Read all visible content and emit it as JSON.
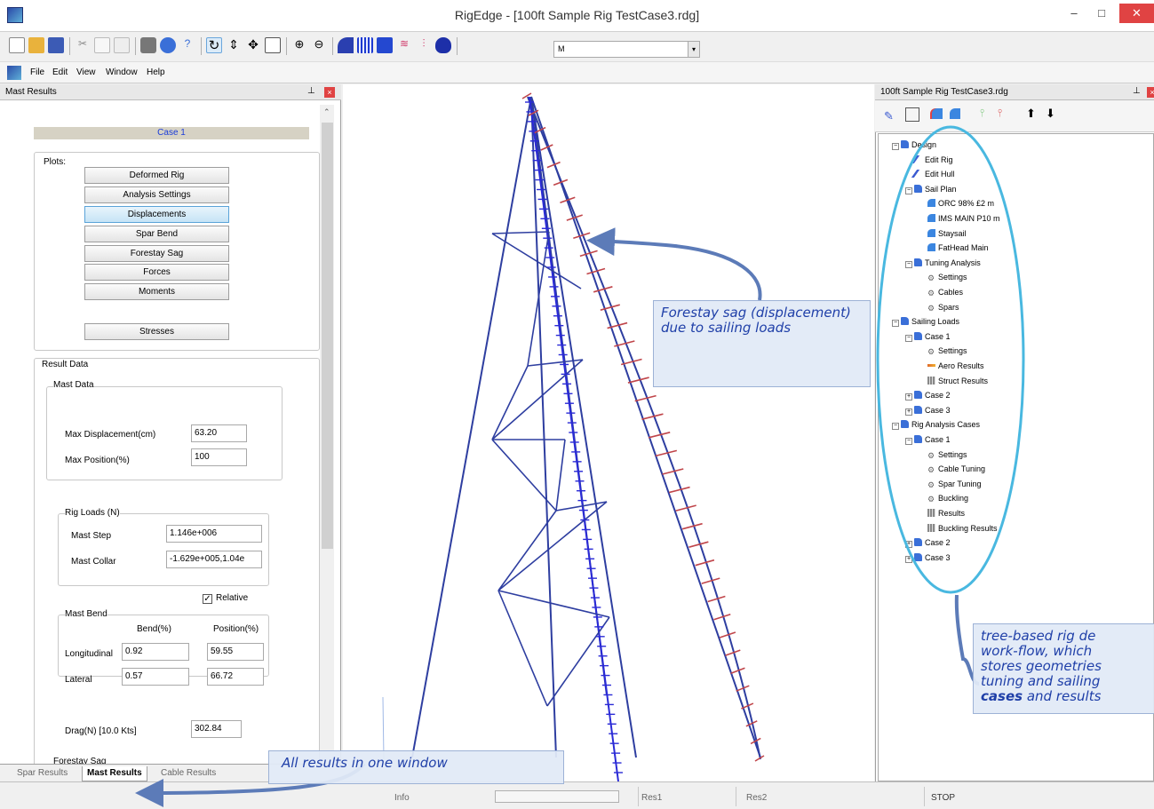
{
  "window": {
    "title": "RigEdge - [100ft Sample Rig TestCase3.rdg]",
    "minimize": "–",
    "maximize": "□",
    "close": "✕"
  },
  "toolbar": {
    "combo_value": "M",
    "combo_arrow": "▾"
  },
  "menubar": {
    "items": [
      "File",
      "Edit",
      "View",
      "Window",
      "Help"
    ]
  },
  "left_panel": {
    "title": "Mast Results",
    "case_label": "Case 1",
    "plots_label": "Plots:",
    "plot_buttons": [
      "Deformed Rig",
      "Analysis Settings",
      "Displacements",
      "Spar Bend",
      "Forestay Sag",
      "Forces",
      "Moments",
      "Stresses"
    ],
    "selected_plot": "Displacements",
    "result_data_label": "Result Data",
    "mast_data_label": "Mast Data",
    "max_displacement_label": "Max Displacement(cm)",
    "max_displacement_value": "63.20",
    "max_position_label": "Max Position(%)",
    "max_position_value": "100",
    "rig_loads_label": "Rig Loads (N)",
    "mast_step_label": "Mast Step",
    "mast_step_value": "1.146e+006",
    "mast_collar_label": "Mast Collar",
    "mast_collar_value": "-1.629e+005,1.04e",
    "relative_label": "Relative",
    "relative_checked": true,
    "mast_bend_label": "Mast Bend",
    "bend_header": "Bend(%)",
    "position_header": "Position(%)",
    "longitudinal_label": "Longitudinal",
    "longitudinal_bend": "0.92",
    "longitudinal_position": "59.55",
    "lateral_label": "Lateral",
    "lateral_bend": "0.57",
    "lateral_position": "66.72",
    "drag_label": "Drag(N) [10.0 Kts]",
    "drag_value": "302.84",
    "forestay_sag_label": "Forestay Sag",
    "tabs": [
      "Spar Results",
      "Mast Results",
      "Cable Results"
    ],
    "active_tab": "Mast Results"
  },
  "right_panel": {
    "title": "100ft Sample Rig TestCase3.rdg",
    "tree": [
      {
        "label": "Design",
        "level": 0,
        "icon": "folder-icon",
        "expander": "−"
      },
      {
        "label": "Edit Rig",
        "level": 1,
        "icon": "pencil-icon"
      },
      {
        "label": "Edit Hull",
        "level": 1,
        "icon": "pencil-icon"
      },
      {
        "label": "Sail Plan",
        "level": 1,
        "icon": "folder-icon",
        "expander": "−"
      },
      {
        "label": "ORC 98% £2 m",
        "level": 2,
        "icon": "sail-icon"
      },
      {
        "label": "IMS MAIN P10 m",
        "level": 2,
        "icon": "sail-icon"
      },
      {
        "label": "Staysail",
        "level": 2,
        "icon": "sail-icon"
      },
      {
        "label": "FatHead Main",
        "level": 2,
        "icon": "sail-icon"
      },
      {
        "label": "Tuning Analysis",
        "level": 1,
        "icon": "folder-icon",
        "expander": "−"
      },
      {
        "label": "Settings",
        "level": 2,
        "icon": "gear-icon"
      },
      {
        "label": "Cables",
        "level": 2,
        "icon": "gear-icon"
      },
      {
        "label": "Spars",
        "level": 2,
        "icon": "gear-icon"
      },
      {
        "label": "Sailing Loads",
        "level": 0,
        "icon": "folder-icon",
        "expander": "−"
      },
      {
        "label": "Case 1",
        "level": 1,
        "icon": "folder-icon",
        "expander": "−"
      },
      {
        "label": "Settings",
        "level": 2,
        "icon": "gear-icon"
      },
      {
        "label": "Aero Results",
        "level": 2,
        "icon": "aero-icon"
      },
      {
        "label": "Struct Results",
        "level": 2,
        "icon": "grid-icon"
      },
      {
        "label": "Case 2",
        "level": 1,
        "icon": "folder-icon",
        "expander": "+"
      },
      {
        "label": "Case 3",
        "level": 1,
        "icon": "folder-icon",
        "expander": "+"
      },
      {
        "label": "Rig Analysis Cases",
        "level": 0,
        "icon": "folder-icon",
        "expander": "−"
      },
      {
        "label": "Case 1",
        "level": 1,
        "icon": "folder-icon",
        "expander": "−"
      },
      {
        "label": "Settings",
        "level": 2,
        "icon": "gear-icon"
      },
      {
        "label": "Cable Tuning",
        "level": 2,
        "icon": "gear-icon"
      },
      {
        "label": "Spar Tuning",
        "level": 2,
        "icon": "gear-icon"
      },
      {
        "label": "Buckling",
        "level": 2,
        "icon": "gear-icon"
      },
      {
        "label": "Results",
        "level": 2,
        "icon": "grid-icon"
      },
      {
        "label": "Buckling Results",
        "level": 2,
        "icon": "grid-icon"
      },
      {
        "label": "Case 2",
        "level": 1,
        "icon": "folder-icon",
        "expander": "+"
      },
      {
        "label": "Case 3",
        "level": 1,
        "icon": "folder-icon",
        "expander": "+"
      }
    ]
  },
  "status_bar": {
    "info": "Info",
    "res1": "Res1",
    "res2": "Res2",
    "stop": "STOP"
  },
  "callouts": {
    "forestay": "Forestay sag (displacement) due to sailing loads",
    "results": "All results in one window",
    "tree_line1": "tree-based rig de",
    "tree_line2": "work-flow, which",
    "tree_line3": "stores geometries",
    "tree_line4": "tuning and sailing",
    "tree_line5_bold": "cases",
    "tree_line5_rest": " and results"
  },
  "colors": {
    "rig_lines": "#2e3ea0",
    "displacement_ticks": "#c0454a",
    "mast": "#2a2ad6",
    "callout_text": "#1f3fa8",
    "annotation_arrow": "#5c7bb8",
    "tree_highlight": "#49b8e0"
  }
}
